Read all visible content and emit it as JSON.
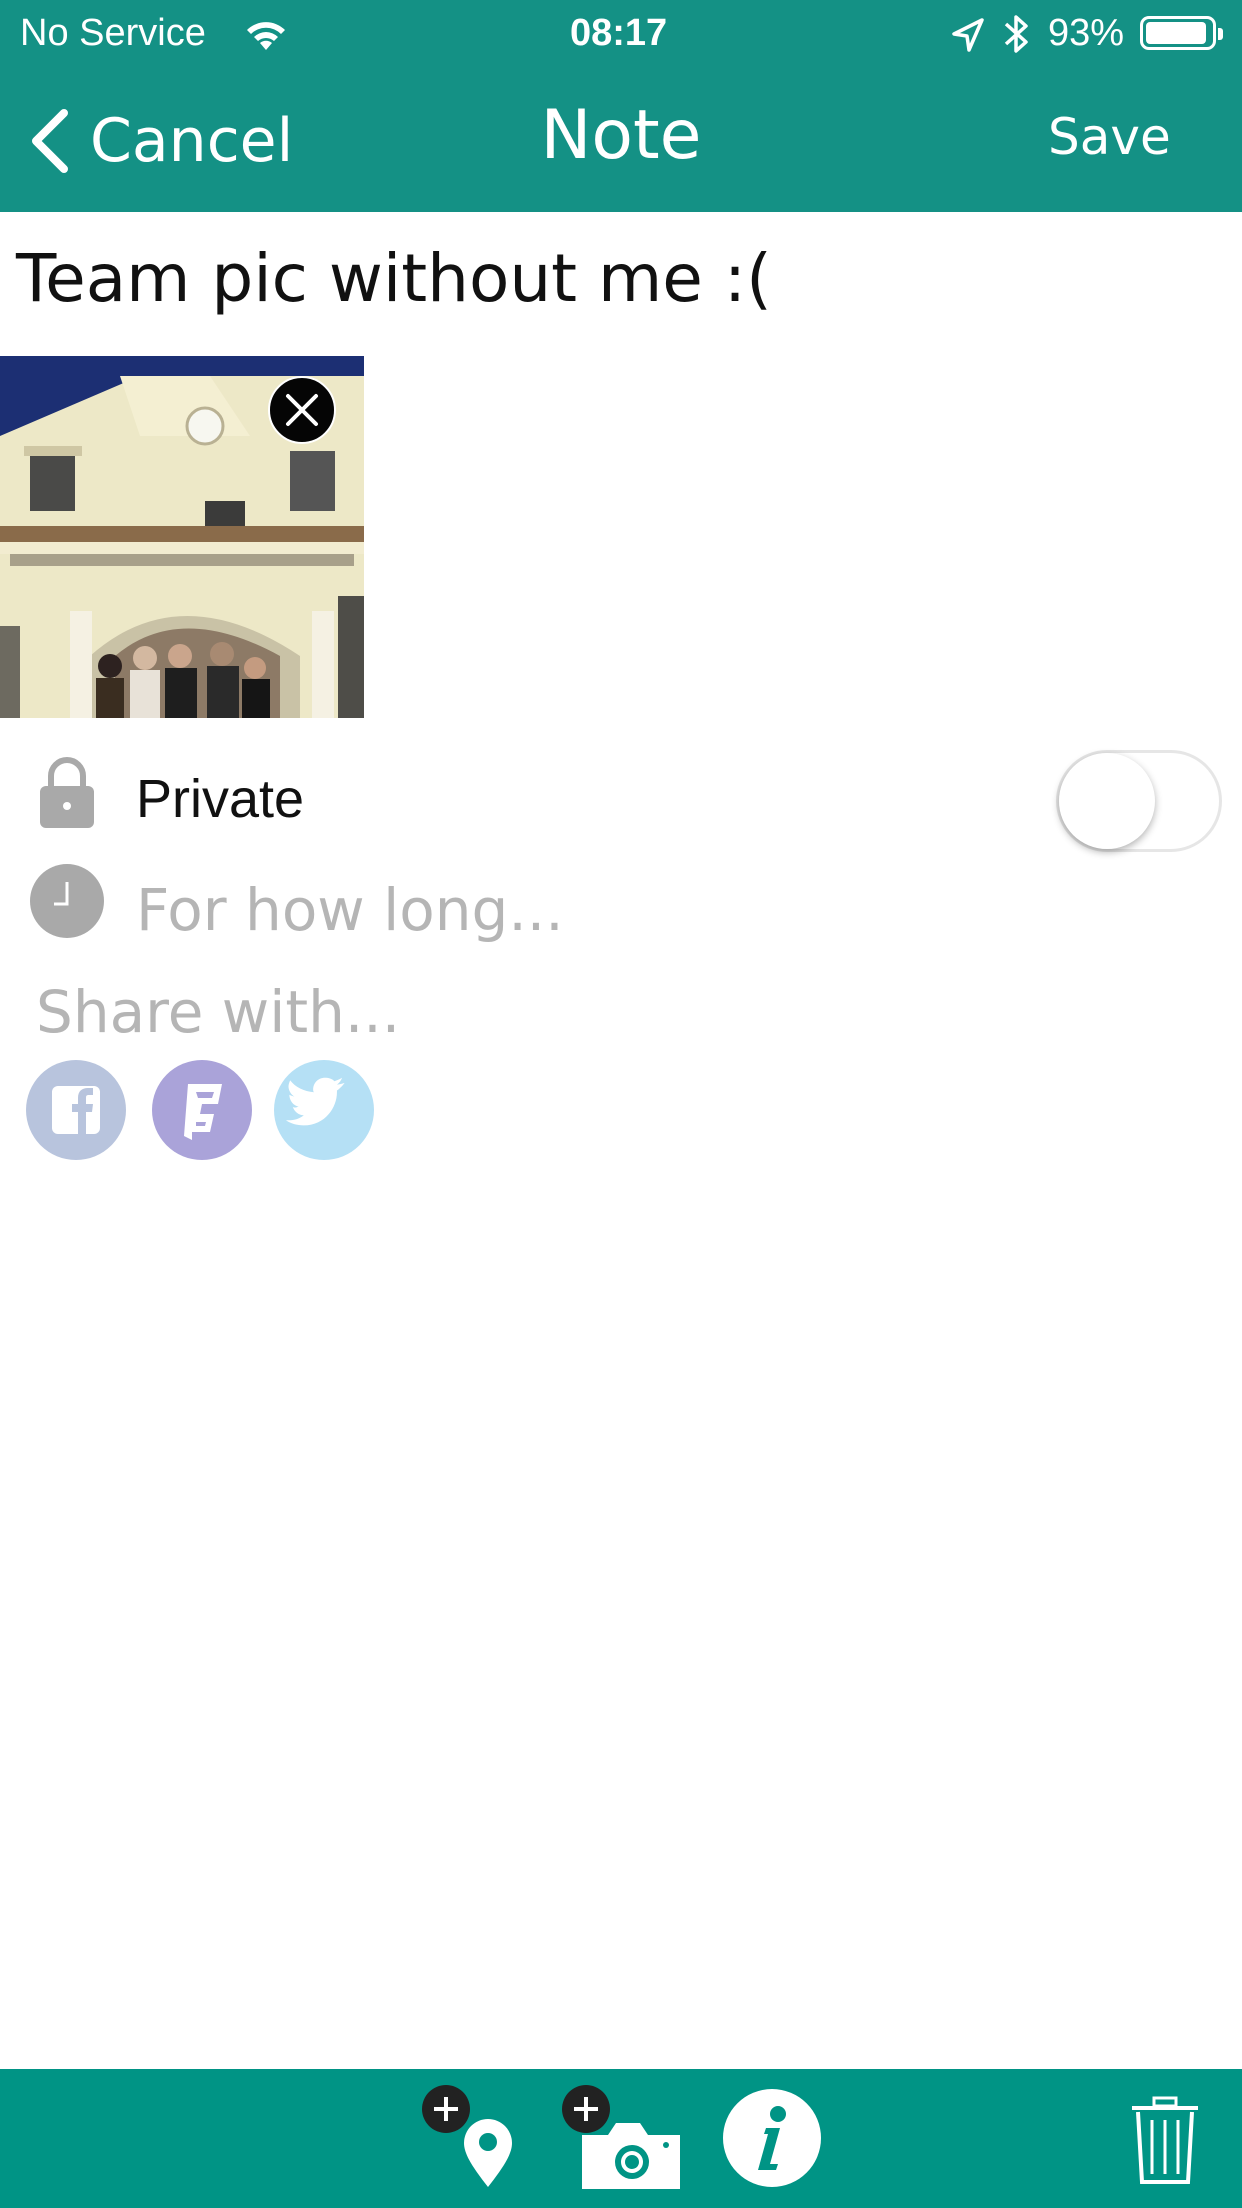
{
  "status_bar": {
    "carrier": "No Service",
    "time": "08:17",
    "battery_percent": "93%",
    "battery_level": 0.93
  },
  "nav": {
    "cancel_label": "Cancel",
    "title": "Note",
    "save_label": "Save"
  },
  "note": {
    "title": "Team pic without me :("
  },
  "privacy": {
    "private_label": "Private",
    "private_enabled": false,
    "duration_placeholder": "For how long..."
  },
  "share": {
    "label": "Share with...",
    "services": [
      {
        "name": "facebook",
        "color": "#b8c4dd"
      },
      {
        "name": "foursquare",
        "color": "#aaa3d9"
      },
      {
        "name": "twitter",
        "color": "#b5e0f5"
      }
    ]
  },
  "colors": {
    "header": "#149185",
    "bottom_bar": "#009485",
    "placeholder": "#b5b5b5"
  },
  "toolbar": {
    "items": [
      "add-location-icon",
      "add-photo-icon",
      "info-icon",
      "trash-icon"
    ]
  }
}
